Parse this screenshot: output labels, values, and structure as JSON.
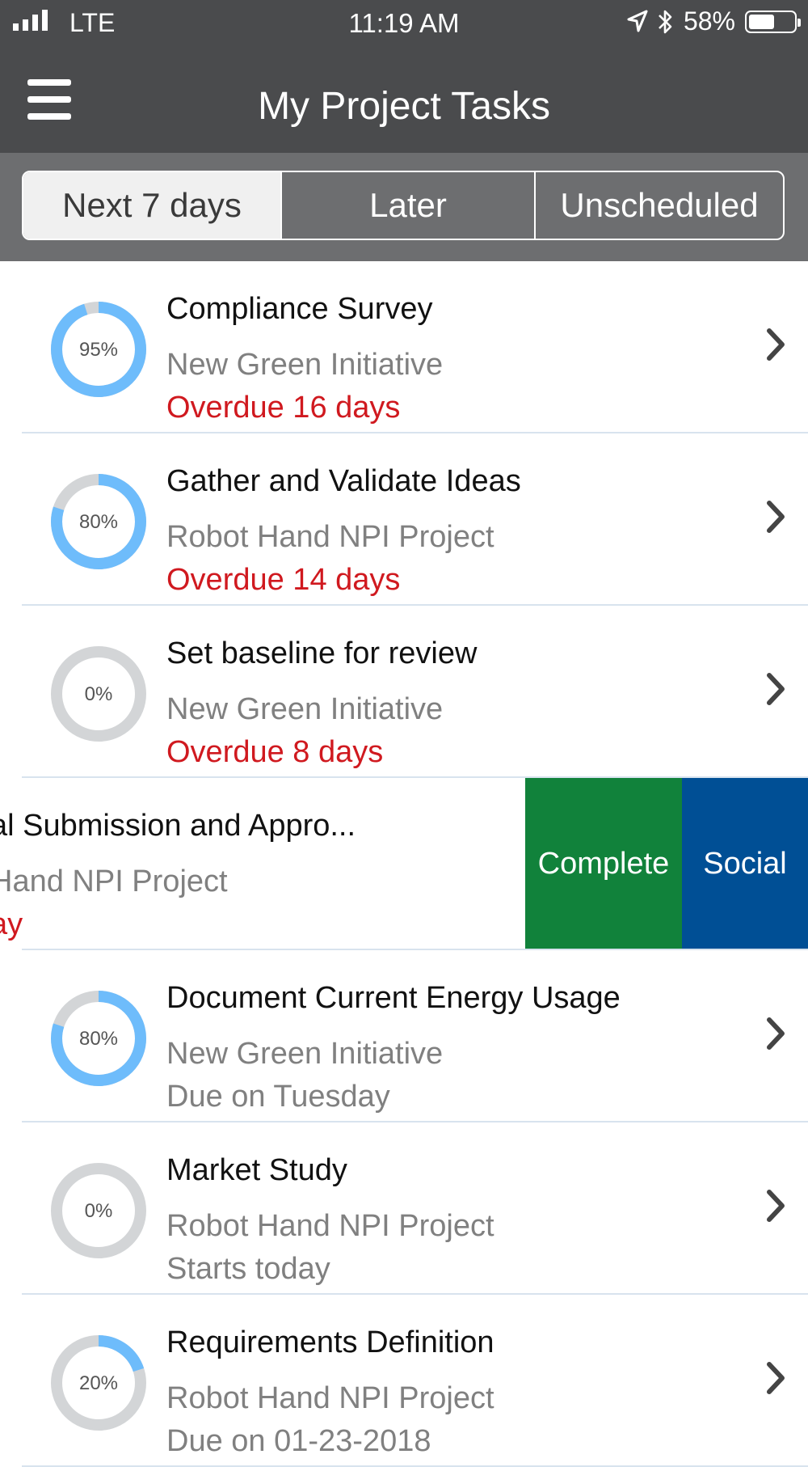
{
  "status_bar": {
    "network": "LTE",
    "time": "11:19 AM",
    "battery": "58%",
    "battery_level": 0.58
  },
  "header": {
    "title": "My Project Tasks"
  },
  "tabs": [
    {
      "label": "Next 7 days",
      "selected": true
    },
    {
      "label": "Later",
      "selected": false
    },
    {
      "label": "Unscheduled",
      "selected": false
    }
  ],
  "colors": {
    "progress": "#6ebcfb",
    "track": "#d3d5d7",
    "overdue": "#d0191f",
    "complete": "#11823b",
    "social": "#004f95"
  },
  "tasks": [
    {
      "title": "Compliance Survey",
      "project": "New Green Initiative",
      "due": "Overdue 16 days",
      "due_status": "overdue",
      "percent_label": "95%",
      "progress": 0.95
    },
    {
      "title": "Gather and Validate Ideas",
      "project": "Robot Hand NPI Project",
      "due": "Overdue 14 days",
      "due_status": "overdue",
      "percent_label": "80%",
      "progress": 0.8
    },
    {
      "title": "Set baseline for review",
      "project": "New Green Initiative",
      "due": "Overdue 8 days",
      "due_status": "overdue",
      "percent_label": "0%",
      "progress": 0.0
    },
    {
      "title": "al Submission and Appro...",
      "project": "Hand NPI Project",
      "due": "ay",
      "due_status": "overdue",
      "swiped": true,
      "actions": {
        "complete": "Complete",
        "social": "Social"
      }
    },
    {
      "title": "Document Current Energy Usage",
      "project": "New Green Initiative",
      "due": "Due on Tuesday",
      "due_status": "normal",
      "percent_label": "80%",
      "progress": 0.8
    },
    {
      "title": "Market Study",
      "project": "Robot Hand NPI Project",
      "due": "Starts today",
      "due_status": "normal",
      "percent_label": "0%",
      "progress": 0.0
    },
    {
      "title": "Requirements Definition",
      "project": "Robot Hand NPI Project",
      "due": "Due on 01-23-2018",
      "due_status": "normal",
      "percent_label": "20%",
      "progress": 0.2
    }
  ]
}
